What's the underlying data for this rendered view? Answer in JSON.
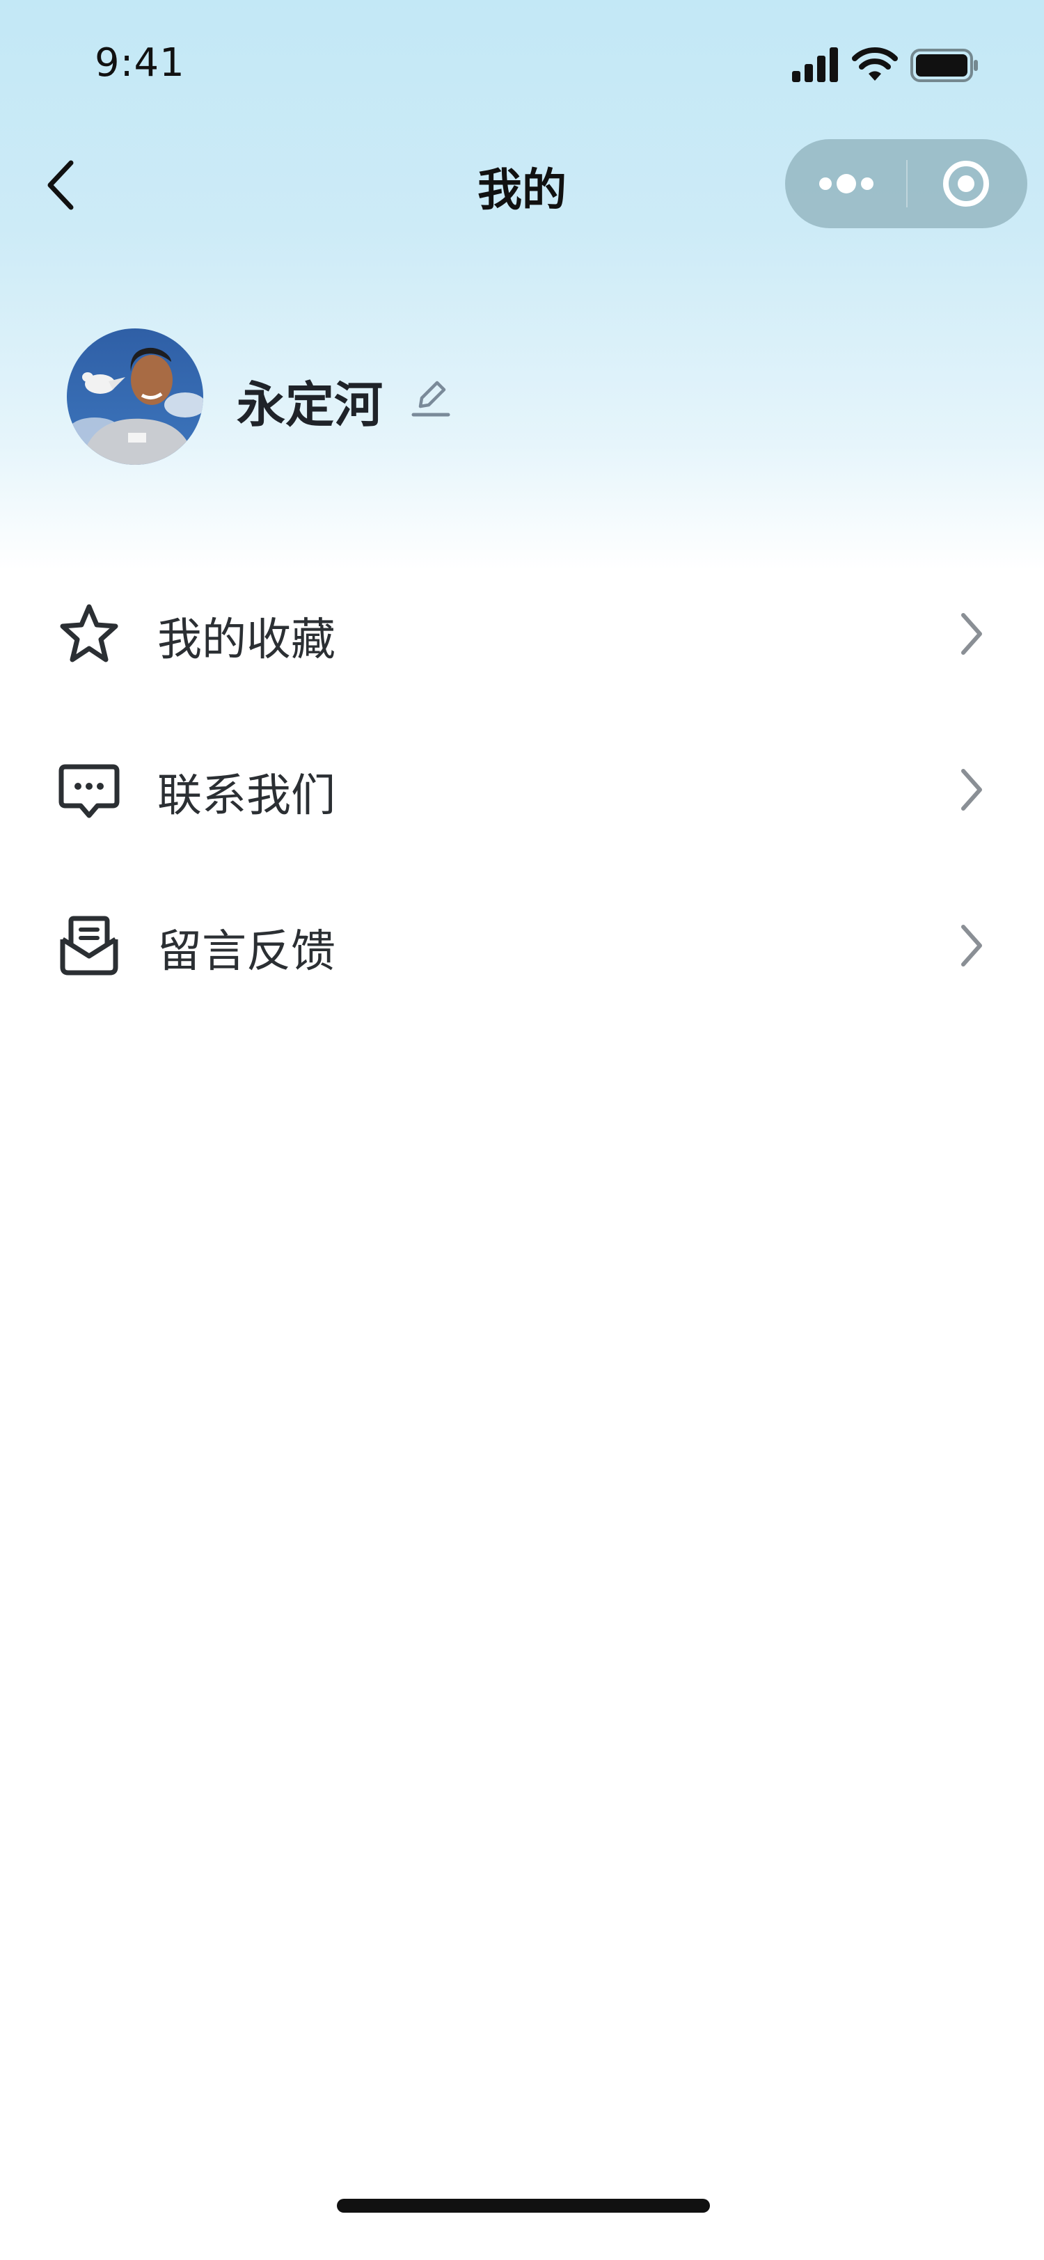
{
  "status_bar": {
    "time": "9:41"
  },
  "nav": {
    "title": "我的"
  },
  "profile": {
    "nickname": "永定河"
  },
  "menu": {
    "items": [
      {
        "label": "我的收藏",
        "icon": "star-icon"
      },
      {
        "label": "联系我们",
        "icon": "chat-bubble-icon"
      },
      {
        "label": "留言反馈",
        "icon": "mail-icon"
      }
    ]
  },
  "colors": {
    "header_gradient_top": "#c3e8f6",
    "text_primary": "#1f2329",
    "chevron": "#8a8f95",
    "capsule": "#8fb0ba"
  }
}
